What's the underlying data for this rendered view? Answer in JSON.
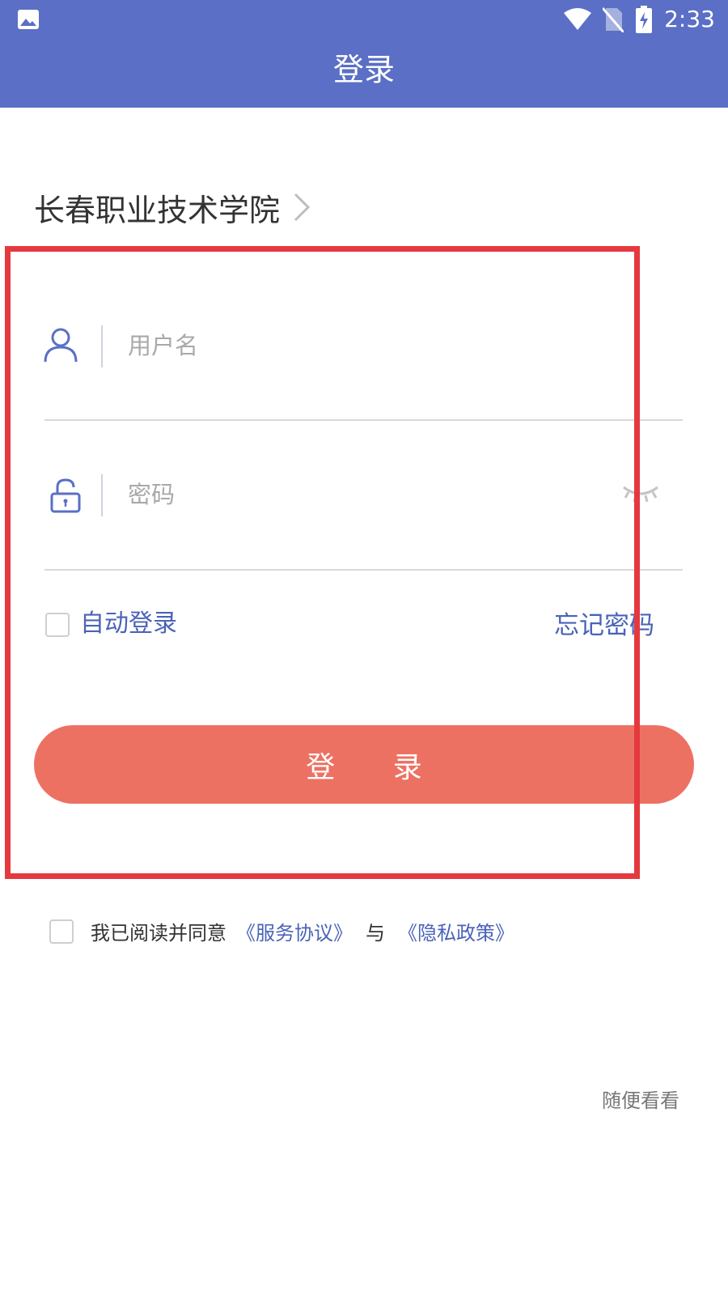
{
  "status_bar": {
    "time": "2:33",
    "icons": [
      "image-icon",
      "wifi-icon",
      "no-sim-icon",
      "battery-charging-icon"
    ]
  },
  "app_bar": {
    "title": "登录"
  },
  "school": {
    "name": "长春职业技术学院"
  },
  "login_form": {
    "username_placeholder": "用户名",
    "password_placeholder": "密码",
    "auto_login_label": "自动登录",
    "forgot_password_label": "忘记密码",
    "login_button_label": "登 录"
  },
  "agreement": {
    "prefix": "我已阅读并同意",
    "service_link": "《服务协议》",
    "and": "与",
    "privacy_link": "《隐私政策》"
  },
  "browse": {
    "label": "随便看看"
  },
  "colors": {
    "primary": "#5a6fc5",
    "accent_link": "#4a63b8",
    "button": "#ed7162",
    "highlight": "#e53940"
  }
}
